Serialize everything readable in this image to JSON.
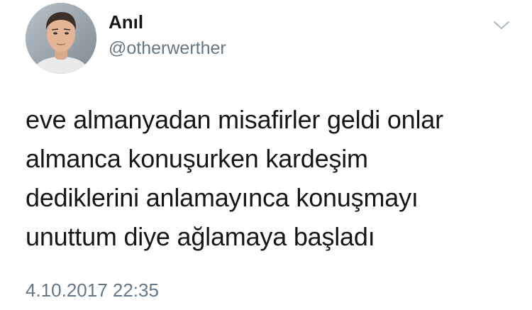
{
  "author": {
    "display_name": "Anıl",
    "handle": "@otherwerther"
  },
  "tweet": {
    "lines": [
      "eve almanyadan misafirler geldi onlar",
      "almanca konuşurken kardeşim",
      "dediklerini anlamayınca konuşmayı",
      "unuttum diye ağlamaya başladı"
    ],
    "timestamp": "4.10.2017 22:35"
  },
  "icons": {
    "menu": "chevron-down-icon",
    "avatar": "profile-photo"
  },
  "colors": {
    "text": "#14171a",
    "secondary": "#657786",
    "background": "#ffffff"
  }
}
